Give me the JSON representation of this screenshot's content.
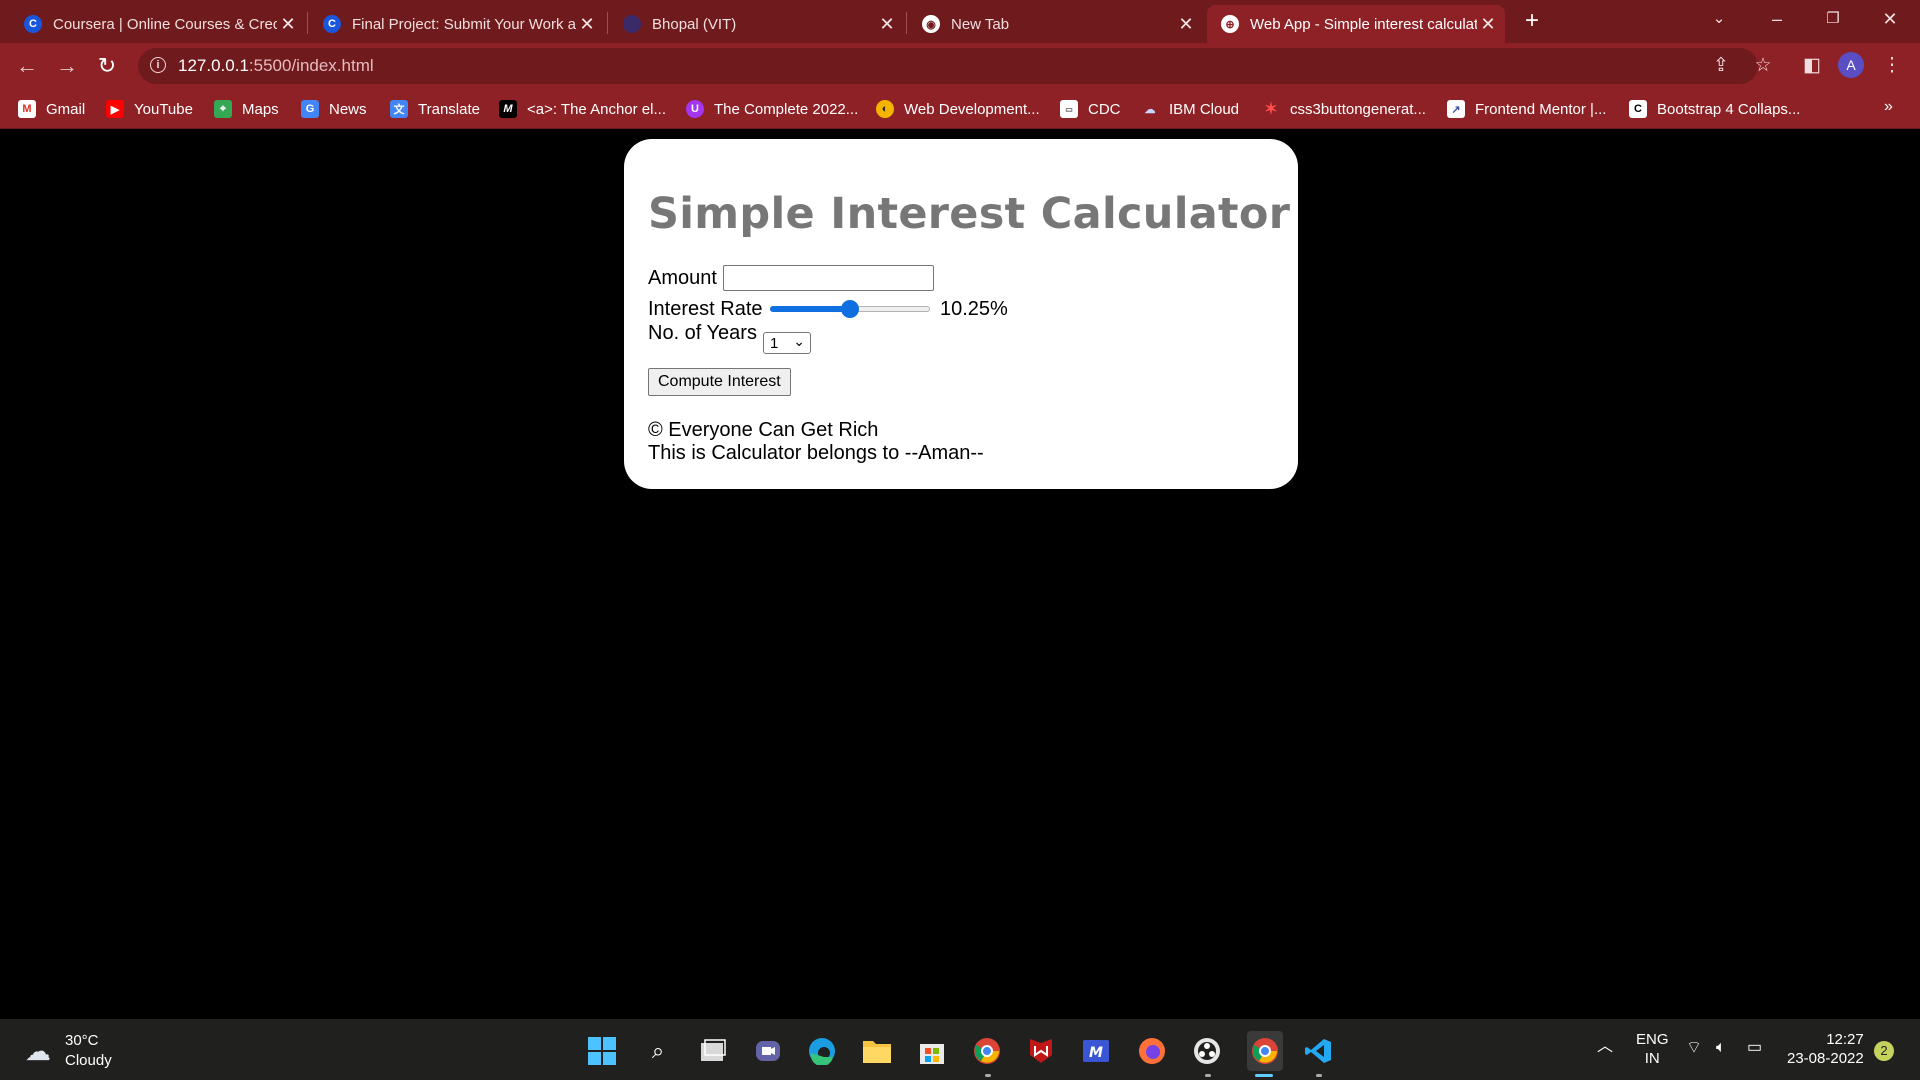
{
  "browser": {
    "tabs": [
      {
        "title": "Coursera | Online Courses & Credentials",
        "favicon": "coursera-icon"
      },
      {
        "title": "Final Project: Submit Your Work and Grade Your Peers",
        "favicon": "coursera-icon"
      },
      {
        "title": "Bhopal (VIT)",
        "favicon": "vit-icon"
      },
      {
        "title": "New Tab",
        "favicon": "chrome-icon"
      },
      {
        "title": "Web App - Simple interest calculator",
        "favicon": "globe-icon"
      }
    ],
    "active_tab_index": 4,
    "url_host": "127.0.0.1",
    "url_path": ":5500/index.html",
    "profile_initial": "A",
    "theme_color": "#8e2126",
    "bookmarks": [
      {
        "label": "Gmail",
        "icon": "gmail-icon"
      },
      {
        "label": "YouTube",
        "icon": "youtube-icon"
      },
      {
        "label": "Maps",
        "icon": "maps-icon"
      },
      {
        "label": "News",
        "icon": "news-icon"
      },
      {
        "label": "Translate",
        "icon": "translate-icon"
      },
      {
        "label": "<a>: The Anchor el...",
        "icon": "mdn-icon"
      },
      {
        "label": "The Complete 2022...",
        "icon": "udemy-icon"
      },
      {
        "label": "Web Development...",
        "icon": "web-dev-icon"
      },
      {
        "label": "CDC",
        "icon": "cdc-icon"
      },
      {
        "label": "IBM Cloud",
        "icon": "ibm-cloud-icon"
      },
      {
        "label": "css3buttongenerat...",
        "icon": "css3-icon"
      },
      {
        "label": "Frontend Mentor |...",
        "icon": "frontend-mentor-icon"
      },
      {
        "label": "Bootstrap 4 Collaps...",
        "icon": "bootstrap-icon"
      }
    ]
  },
  "app": {
    "title": "Simple Interest Calculator",
    "amount_label": "Amount",
    "amount_value": "",
    "rate_label": "Interest Rate",
    "rate_value_text": "10.25%",
    "rate_fraction": 0.5,
    "years_label": "No. of Years",
    "years_value": "1",
    "compute_button": "Compute Interest",
    "footer_line1": "© Everyone Can Get Rich",
    "footer_line2": "This is Calculator belongs to --Aman--",
    "heading_color": "#777777",
    "slider_color": "#0f6fe0"
  },
  "taskbar": {
    "weather_temp": "30°C",
    "weather_desc": "Cloudy",
    "lang_line1": "ENG",
    "lang_line2": "IN",
    "time": "12:27",
    "date": "23-08-2022",
    "notification_count": "2"
  }
}
